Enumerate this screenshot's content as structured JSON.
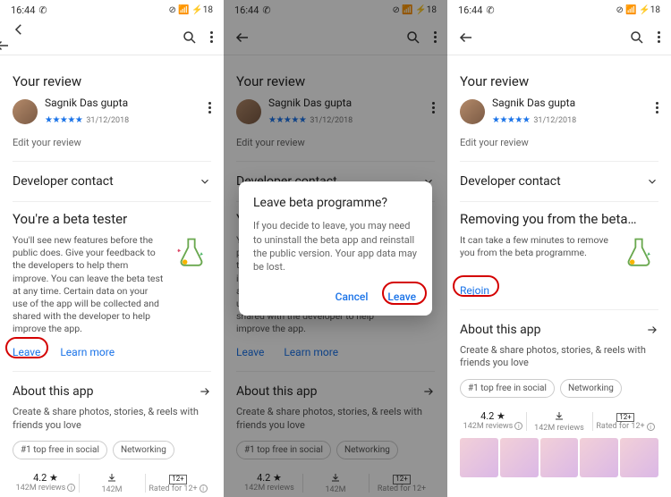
{
  "status": {
    "time": "16:44",
    "icons_right": "⊘ 📶 ⚡18"
  },
  "review": {
    "section_title": "Your review",
    "name": "Sagnik Das gupta",
    "stars": "★★★★★",
    "date": "31/12/2018",
    "edit": "Edit your review"
  },
  "developer_contact": {
    "label": "Developer contact"
  },
  "beta": {
    "title": "You're a beta tester",
    "body": "You'll see new features before the public does. Give your feedback to the developers to help them improve. You can leave the beta test at any time. Certain data on your use of the app will be collected and shared with the developer to help improve the app.",
    "leave": "Leave",
    "learn_more": "Learn more"
  },
  "beta_removing": {
    "title": "Removing you from the beta…",
    "body": "It can take a few minutes to remove you from the beta programme.",
    "rejoin": "Rejoin"
  },
  "about": {
    "title": "About this app",
    "desc": "Create & share photos, stories, & reels with friends you love",
    "chip1": "#1 top free in social",
    "chip2": "Networking"
  },
  "stats": {
    "rating": "4.2 ★",
    "reviews": "142M reviews",
    "downloads": "142M",
    "downloads_label": "Downloads",
    "age_badge": "12+",
    "age_label": "Rated for 12+"
  },
  "dialog": {
    "title": "Leave beta programme?",
    "body": "If you decide to leave, you may need to uninstall the beta app and reinstall the public version. Your app data may be lost.",
    "cancel": "Cancel",
    "leave": "Leave"
  }
}
